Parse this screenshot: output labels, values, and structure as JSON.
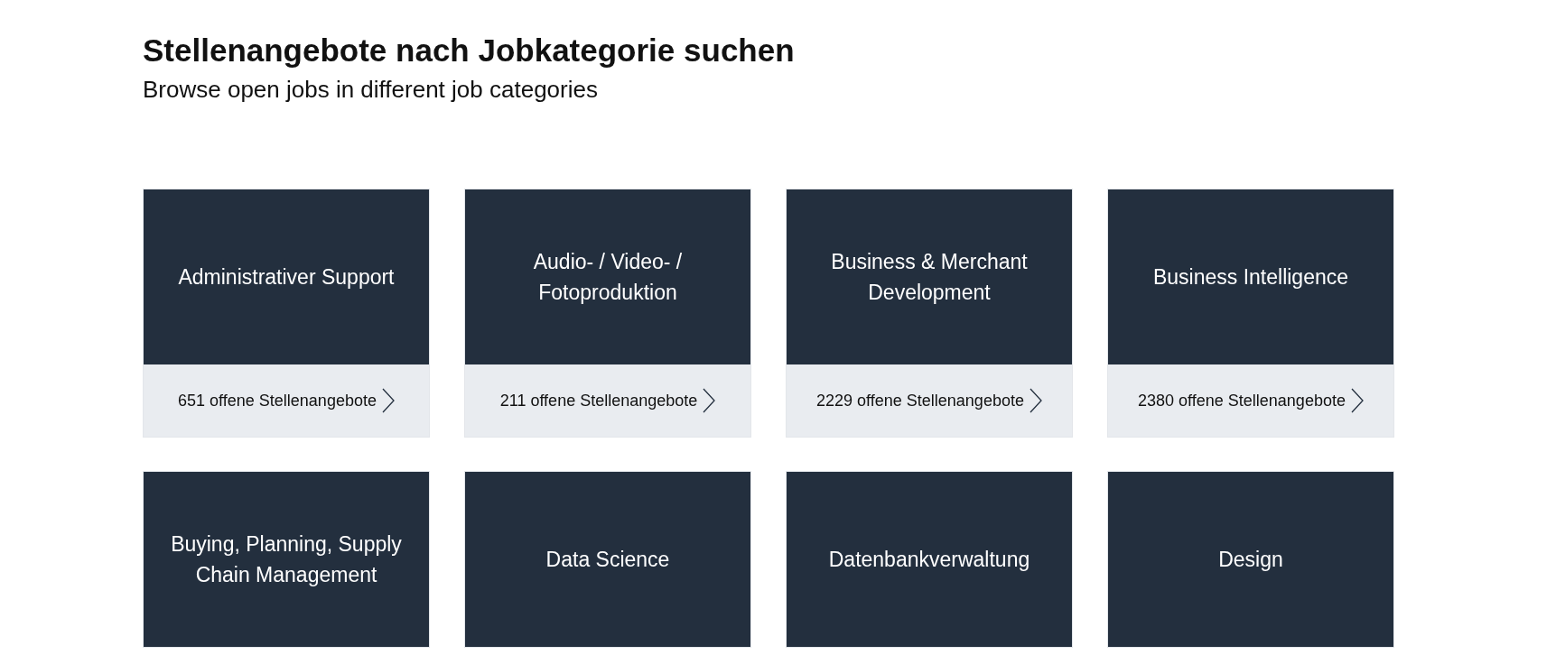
{
  "heading": "Stellenangebote nach Jobkategorie suchen",
  "subheading": "Browse open jobs in different job categories",
  "categories": [
    {
      "title": "Administrativer Support",
      "count": "651 offene Stellenangebote"
    },
    {
      "title": "Audio- / Video- / Fotoproduktion",
      "count": "211 offene Stellenangebote"
    },
    {
      "title": "Business & Merchant Development",
      "count": "2229 offene Stellenangebote"
    },
    {
      "title": "Business Intelligence",
      "count": "2380 offene Stellenangebote"
    },
    {
      "title": "Buying, Planning, Supply Chain Management"
    },
    {
      "title": "Data Science"
    },
    {
      "title": "Datenbankverwaltung"
    },
    {
      "title": "Design"
    }
  ]
}
